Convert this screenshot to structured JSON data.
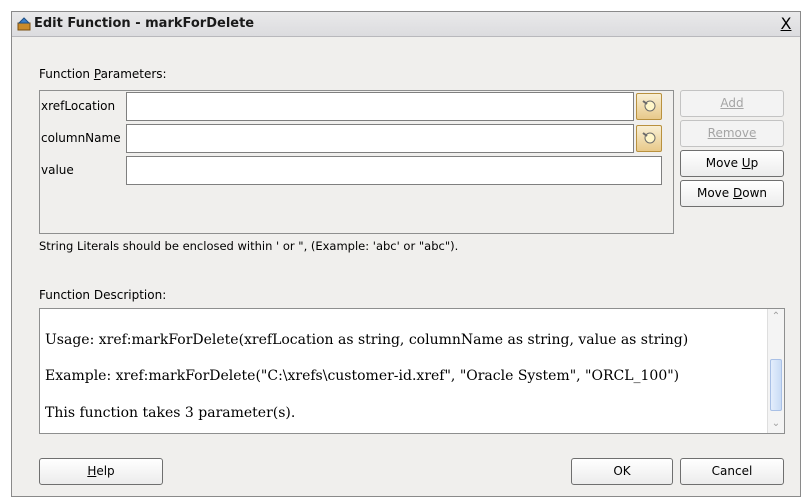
{
  "window": {
    "title": "Edit Function - markForDelete",
    "close_label": "X",
    "title_icon": "function-edit-icon"
  },
  "parameters": {
    "section_label": "Function ",
    "section_label_mnemonic": "P",
    "section_label_rest": "arameters:",
    "rows": [
      {
        "name": "xrefLocation",
        "value": "",
        "has_picker": true
      },
      {
        "name": "columnName",
        "value": "",
        "has_picker": true
      },
      {
        "name": "value",
        "value": "",
        "has_picker": false
      }
    ],
    "hint": "String Literals should be enclosed within ' or \", (Example: 'abc' or \"abc\")."
  },
  "side_buttons": {
    "add": {
      "label": "Add",
      "mnemonic_index": 0,
      "enabled": false
    },
    "remove": {
      "label": "Remove",
      "mnemonic_index": 0,
      "enabled": false
    },
    "move_up_pre": "Move ",
    "move_up_mn": "U",
    "move_up_post": "p",
    "move_down_pre": "Move ",
    "move_down_mn": "D",
    "move_down_post": "own"
  },
  "description": {
    "section_label": "Function Description:",
    "lines": [
      "Usage: xref:markForDelete(xrefLocation as string, columnName as string, value as string)",
      "Example: xref:markForDelete(\"C:\\xrefs\\customer-id.xref\", \"Oracle System\", \"ORCL_100\")",
      "This function takes 3 parameter(s)."
    ]
  },
  "footer": {
    "help_mn": "H",
    "help_rest": "elp",
    "ok": "OK",
    "cancel": "Cancel"
  },
  "colors": {
    "dialog_bg": "#f0efed",
    "picker_accent": "#e8c98a"
  }
}
